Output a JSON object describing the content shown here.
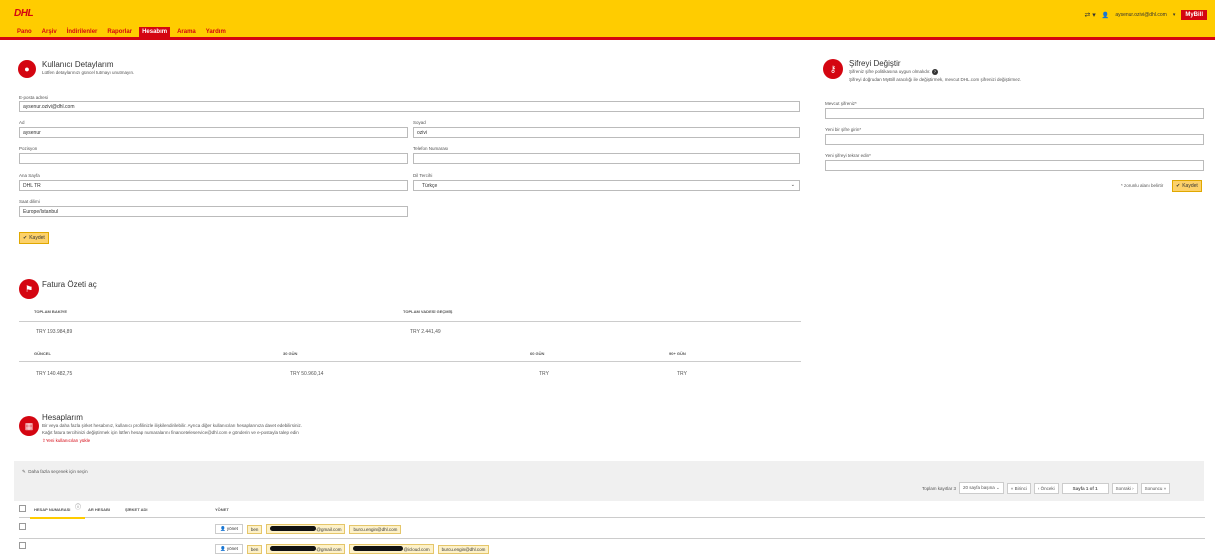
{
  "header": {
    "logo_text": "DHL",
    "nav": [
      "Pano",
      "Arşiv",
      "İndirilenler",
      "Raporlar",
      "Hesabım",
      "Arama",
      "Yardım"
    ],
    "user_email": "aysenur.ozivi@dhl.com",
    "mybill_label": "MyBill"
  },
  "user_details": {
    "title": "Kullanıcı Detaylarım",
    "subtitle": "Lütfen detaylarınızı güncel tutmayı unutmayın.",
    "email_label": "E-posta adresi",
    "email_value": "aysenur.ozivi@dhl.com",
    "name_label": "Ad",
    "name_value": "aysenur",
    "surname_label": "Soyad",
    "surname_value": "ozivi",
    "position_label": "Pozisyon",
    "position_value": "",
    "phone_label": "Telefon Numarası",
    "phone_value": "",
    "home_label": "Ana Sayfa",
    "home_value": "DHL TR",
    "lang_label": "Dil Tercihi",
    "lang_value": "Türkçe",
    "tz_label": "Saat dilimi",
    "tz_value": "Europe/Istanbul",
    "save_label": "Kaydet"
  },
  "password": {
    "title": "Şifreyi Değiştir",
    "subtitle1": "Şifreniz şifre politikasına uygun olmalıdır.",
    "subtitle2": "Şifreyi doğrudan MyBill aracılığı ile değiştirmek, mevcut DHL.com şifrenizi değiştirmez.",
    "current_label": "Mevcut şifreniz*",
    "new_label": "Yeni bir şifre girin*",
    "confirm_label": "Yeni şifreyi tekrar edin*",
    "required_note": "* zorunlu alanı belirtir",
    "save_label": "Kaydet"
  },
  "invoice": {
    "title": "Fatura Özeti aç",
    "h_total_balance": "TOPLAM BAKİYE",
    "h_total_overdue": "TOPLAM VADESİ GEÇMİŞ",
    "v_total_balance": "TRY 193.984,89",
    "v_total_overdue": "TRY 2.441,49",
    "h_current": "GÜNCEL",
    "h_30": "30 GÜN",
    "h_60": "60 GÜN",
    "h_90": "90+ GÜN",
    "v_current": "TRY 140.482,75",
    "v_30": "TRY 50.960,14",
    "v_60": "TRY",
    "v_90": "TRY"
  },
  "accounts": {
    "title": "Hesaplarım",
    "desc1": "Bir veya daha fazla şirket hesabınız, kullanıcı profilinizle ilişkilendirilebilir. Ayrıca diğer kullanıcıları hesaplarınıza davet edebilirsiniz.",
    "desc2": "Kağıt fatura tercihinizi değiştirmek için lütfen hesap numaralarını financeteleservice@dhl.com e gönderin ve e-postayla talep edin",
    "upload_link": "Yeni kullanıcıları yükle",
    "bulk_label": "Daha fazla seçenek için seçin",
    "total_records": "Toplam kayıtlar 3",
    "per_page": "20 sayfa başına",
    "first": "« Birinci",
    "prev": "‹ Önceki",
    "page": "Sayfa 1 of 1",
    "next": "Sonraki ›",
    "last": "Sonuncu »",
    "cols": [
      "HESAP NUMARASI",
      "AR HESABI",
      "ŞİRKET ADI",
      "YÖNET"
    ],
    "manage_label": "yönet",
    "rows": [
      {
        "tags": [
          "ben",
          "@gmail.com",
          "burcu.engin@dhl.com"
        ]
      },
      {
        "tags": [
          "ben",
          "@gmail.com",
          "@icloud.com",
          "burcu.engin@dhl.com"
        ]
      }
    ]
  }
}
